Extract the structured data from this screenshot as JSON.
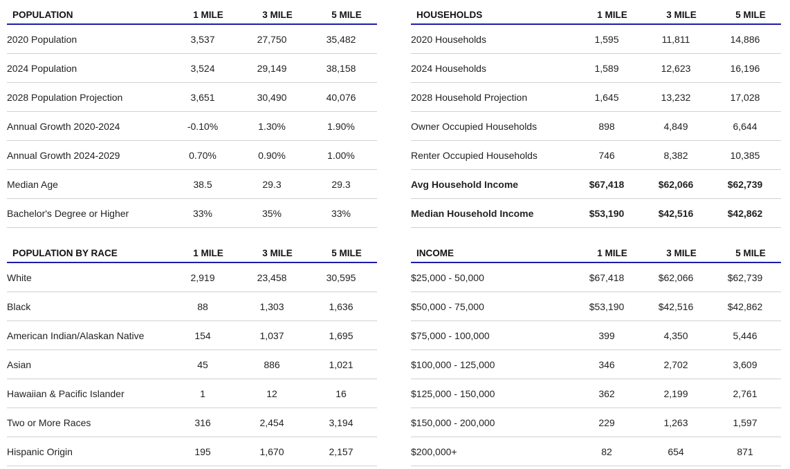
{
  "population": {
    "title": "POPULATION",
    "cols": [
      "1 MILE",
      "3 MILE",
      "5 MILE"
    ],
    "rows": [
      {
        "label": "2020 Population",
        "v": [
          "3,537",
          "27,750",
          "35,482"
        ]
      },
      {
        "label": "2024 Population",
        "v": [
          "3,524",
          "29,149",
          "38,158"
        ]
      },
      {
        "label": "2028 Population Projection",
        "v": [
          "3,651",
          "30,490",
          "40,076"
        ]
      },
      {
        "label": "Annual Growth 2020-2024",
        "v": [
          "-0.10%",
          "1.30%",
          "1.90%"
        ]
      },
      {
        "label": "Annual Growth 2024-2029",
        "v": [
          "0.70%",
          "0.90%",
          "1.00%"
        ]
      },
      {
        "label": "Median Age",
        "v": [
          "38.5",
          "29.3",
          "29.3"
        ]
      },
      {
        "label": "Bachelor's Degree or Higher",
        "v": [
          "33%",
          "35%",
          "33%"
        ]
      }
    ]
  },
  "households": {
    "title": "HOUSEHOLDS",
    "cols": [
      "1 MILE",
      "3 MILE",
      "5 MILE"
    ],
    "rows": [
      {
        "label": "2020 Households",
        "v": [
          "1,595",
          "11,811",
          "14,886"
        ]
      },
      {
        "label": "2024 Households",
        "v": [
          "1,589",
          "12,623",
          "16,196"
        ]
      },
      {
        "label": "2028 Household Projection",
        "v": [
          "1,645",
          "13,232",
          "17,028"
        ]
      },
      {
        "label": "Owner Occupied Households",
        "v": [
          "898",
          "4,849",
          "6,644"
        ]
      },
      {
        "label": "Renter Occupied Households",
        "v": [
          "746",
          "8,382",
          "10,385"
        ]
      },
      {
        "label": "Avg Household Income",
        "v": [
          "$67,418",
          "$62,066",
          "$62,739"
        ]
      },
      {
        "label": "Median Household Income",
        "v": [
          "$53,190",
          "$42,516",
          "$42,862"
        ]
      }
    ]
  },
  "race": {
    "title": "POPULATION BY RACE",
    "cols": [
      "1 MILE",
      "3 MILE",
      "5 MILE"
    ],
    "rows": [
      {
        "label": "White",
        "v": [
          "2,919",
          "23,458",
          "30,595"
        ]
      },
      {
        "label": "Black",
        "v": [
          "88",
          "1,303",
          "1,636"
        ]
      },
      {
        "label": "American Indian/Alaskan Native",
        "v": [
          "154",
          "1,037",
          "1,695"
        ]
      },
      {
        "label": "Asian",
        "v": [
          "45",
          "886",
          "1,021"
        ]
      },
      {
        "label": "Hawaiian & Pacific Islander",
        "v": [
          "1",
          "12",
          "16"
        ]
      },
      {
        "label": "Two or More Races",
        "v": [
          "316",
          "2,454",
          "3,194"
        ]
      },
      {
        "label": "Hispanic Origin",
        "v": [
          "195",
          "1,670",
          "2,157"
        ]
      }
    ]
  },
  "income": {
    "title": "INCOME",
    "cols": [
      "1 MILE",
      "3 MILE",
      "5 MILE"
    ],
    "rows": [
      {
        "label": "$25,000 - 50,000",
        "v": [
          "$67,418",
          "$62,066",
          "$62,739"
        ]
      },
      {
        "label": "$50,000 - 75,000",
        "v": [
          "$53,190",
          "$42,516",
          "$42,862"
        ]
      },
      {
        "label": "$75,000 - 100,000",
        "v": [
          "399",
          "4,350",
          "5,446"
        ]
      },
      {
        "label": "$100,000 - 125,000",
        "v": [
          "346",
          "2,702",
          "3,609"
        ]
      },
      {
        "label": "$125,000 - 150,000",
        "v": [
          "362",
          "2,199",
          "2,761"
        ]
      },
      {
        "label": "$150,000 - 200,000",
        "v": [
          "229",
          "1,263",
          "1,597"
        ]
      },
      {
        "label": "$200,000+",
        "v": [
          "82",
          "654",
          "871"
        ]
      }
    ]
  },
  "colors": {
    "header_rule": "#1c1ca8",
    "row_rule": "#d0d0d0"
  }
}
